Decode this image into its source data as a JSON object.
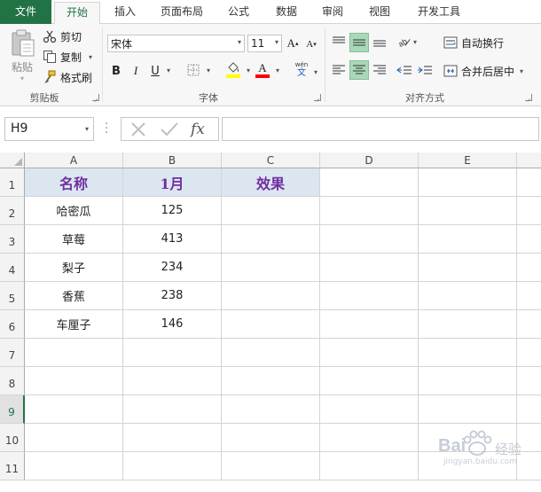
{
  "tabs": [
    {
      "label": "文件"
    },
    {
      "label": "开始"
    },
    {
      "label": "插入"
    },
    {
      "label": "页面布局"
    },
    {
      "label": "公式"
    },
    {
      "label": "数据"
    },
    {
      "label": "审阅"
    },
    {
      "label": "视图"
    },
    {
      "label": "开发工具"
    }
  ],
  "active_tab": "开始",
  "clipboard": {
    "paste_label": "粘贴",
    "cut_label": "剪切",
    "copy_label": "复制",
    "format_painter_label": "格式刷",
    "group_label": "剪贴板"
  },
  "font": {
    "name": "宋体",
    "size": "11",
    "group_label": "字体",
    "bold": "B",
    "italic": "I",
    "underline": "U",
    "grow": "A",
    "shrink": "A",
    "font_color_letter": "A",
    "phonetic_top": "wén",
    "phonetic_bottom": "文",
    "fill_color": "#ffff00",
    "text_color": "#ff0000"
  },
  "alignment": {
    "wrap_label": "自动换行",
    "merge_label": "合并后居中",
    "group_label": "对齐方式"
  },
  "formula_bar": {
    "name_box": "H9",
    "fx": "fx",
    "formula": ""
  },
  "sheet": {
    "columns": [
      "A",
      "B",
      "C",
      "D",
      "E"
    ],
    "rows": [
      "1",
      "2",
      "3",
      "4",
      "5",
      "6",
      "7",
      "8",
      "9",
      "10",
      "11"
    ],
    "selected_row": "9",
    "header_row": [
      "名称",
      "1月",
      "效果"
    ],
    "data": [
      [
        "哈密瓜",
        "125"
      ],
      [
        "草莓",
        "413"
      ],
      [
        "梨子",
        "234"
      ],
      [
        "香蕉",
        "238"
      ],
      [
        "车厘子",
        "146"
      ]
    ],
    "header_fill": "#dce6f1",
    "header_text_color": "#7030a0"
  },
  "watermark": {
    "brand": "Bai",
    "brand_cn": "经验",
    "url": "jingyan.baidu.com"
  },
  "accent": "#217346"
}
